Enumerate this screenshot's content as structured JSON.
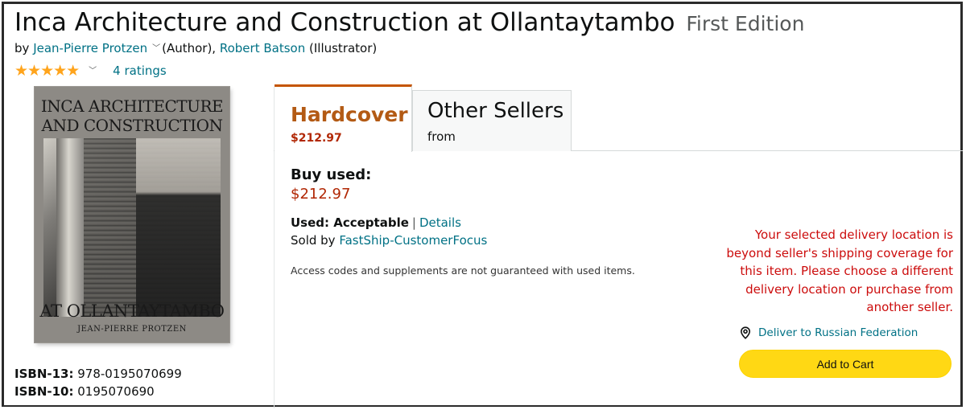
{
  "product": {
    "title": "Inca Architecture and Construction at Ollantaytambo",
    "edition": "First Edition",
    "byline_prefix": "by",
    "author": "Jean-Pierre Protzen",
    "author_role": "(Author),",
    "illustrator": "Robert Batson",
    "illustrator_role": "(Illustrator)",
    "stars": "★★★★★",
    "ratings_count": "4 ratings",
    "rating_value": 5,
    "rating_max": 5
  },
  "cover": {
    "title_line1": "INCA ARCHITECTURE",
    "title_line2": "AND CONSTRUCTION",
    "title_line3": "AT OLLANTAYTAMBO",
    "author": "JEAN-PIERRE PROTZEN"
  },
  "isbn": {
    "isbn13_label": "ISBN-13:",
    "isbn13_value": "978-0195070699",
    "isbn10_label": "ISBN-10:",
    "isbn10_value": "0195070690"
  },
  "tabs": [
    {
      "label": "Hardcover",
      "price": "$212.97",
      "selected": true
    },
    {
      "label": "Other Sellers",
      "sub": "from",
      "selected": false
    }
  ],
  "offer": {
    "buy_used_label": "Buy used:",
    "price": "$212.97",
    "condition_label": "Used: Acceptable",
    "separator": "|",
    "details_link": "Details",
    "sold_by_label": "Sold by",
    "seller": "FastShip-CustomerFocus",
    "note": "Access codes and supplements are not guaranteed with used items."
  },
  "buybox": {
    "warning": "Your selected delivery location is beyond seller's shipping coverage for this item. Please choose a different delivery location or purchase from another seller.",
    "deliver_to": "Deliver to Russian Federation",
    "add_to_cart": "Add to Cart"
  },
  "colors": {
    "link": "#007185",
    "price": "#b12704",
    "tab_accent": "#c45500",
    "star": "#ffa41c",
    "warning": "#cc0c0c",
    "cart_button": "#ffd814"
  }
}
